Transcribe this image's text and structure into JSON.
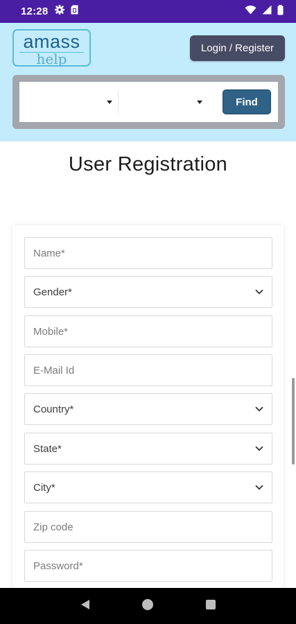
{
  "status_bar": {
    "time": "12:28",
    "icons": [
      "gear-icon",
      "sim-card-icon",
      "wifi-icon",
      "signal-icon",
      "battery-icon"
    ]
  },
  "header": {
    "logo": {
      "top_text": "amass",
      "bottom_text": "help"
    },
    "login_register_label": "Login / Register",
    "search": {
      "select_one_value": "",
      "select_two_value": "",
      "find_label": "Find"
    }
  },
  "page": {
    "title": "User Registration"
  },
  "form": {
    "fields": [
      {
        "label": "Name*",
        "type": "input"
      },
      {
        "label": "Gender*",
        "type": "select"
      },
      {
        "label": "Mobile*",
        "type": "input"
      },
      {
        "label": "E-Mail Id",
        "type": "input"
      },
      {
        "label": "Country*",
        "type": "select"
      },
      {
        "label": "State*",
        "type": "select"
      },
      {
        "label": "City*",
        "type": "select"
      },
      {
        "label": "Zip code",
        "type": "input"
      },
      {
        "label": "Password*",
        "type": "input"
      }
    ]
  },
  "nav_bar": {
    "icons": [
      "back-icon",
      "home-icon",
      "recents-icon"
    ]
  },
  "colors": {
    "status_bar": "#4a1ea3",
    "header_bg": "#c2ecfb",
    "login_button": "#474b63",
    "find_button": "#2f6286",
    "search_panel": "#a3a6ac",
    "logo_text": "#1f5f8e",
    "logo_accent": "#5bbbd4"
  }
}
